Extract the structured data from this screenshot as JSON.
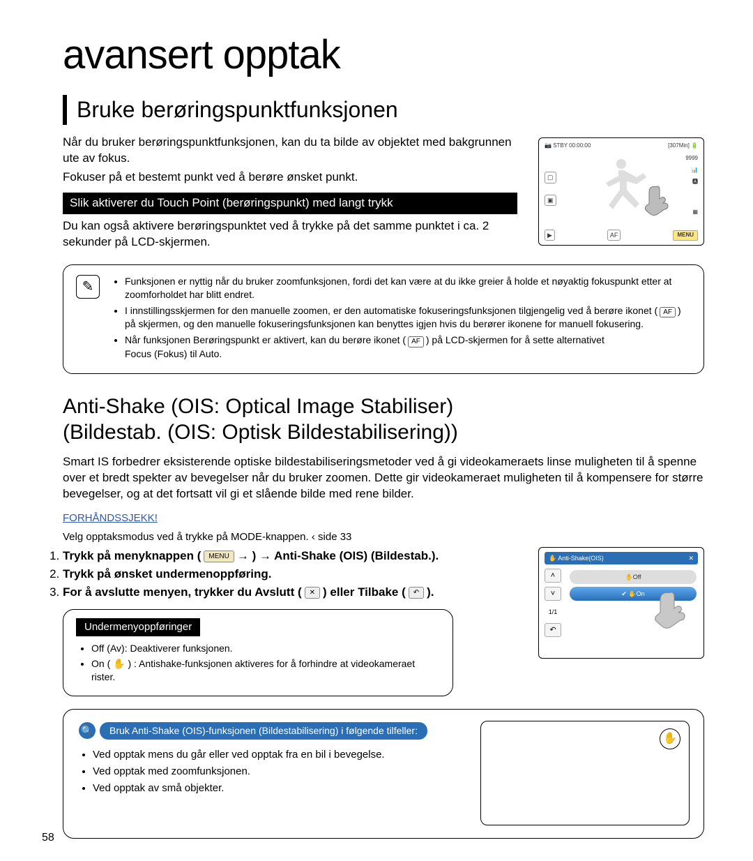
{
  "page_number": "58",
  "page_title": "avansert opptak",
  "section1": {
    "heading": "Bruke berøringspunktfunksjonen",
    "intro1": "Når du bruker berøringspunktfunksjonen, kan du ta bilde av objektet med bakgrunnen ute av fokus.",
    "intro2": "Fokuser på et bestemt punkt ved å berøre ønsket punkt.",
    "black_bar": "Slik aktiverer du Touch Point (berøringspunkt) med langt trykk",
    "after_bar": "Du kan også aktivere berøringspunktet ved å trykke på det samme punktet i ca. 2 sekunder på LCD-skjermen.",
    "lcd": {
      "stby": "STBY",
      "time": "00:00:00",
      "remain": "[307Min]",
      "res": "9999",
      "af": "AF",
      "menu": "MENU"
    },
    "note": {
      "b1": "Funksjonen er nyttig når du bruker zoomfunksjonen, fordi det kan være at du ikke greier å holde et nøyaktig fokuspunkt etter at zoomforholdet har blitt endret.",
      "b2a": "I innstillingsskjermen for den manuelle zoomen, er den automatiske fokuseringsfunksjonen tilgjengelig ved å berøre ikonet (",
      "b2b": ") på skjermen, og den manuelle fokuseringsfunksjonen kan benyttes igjen hvis du berører ikonene for manuell fokusering.",
      "b3a": "Når funksjonen Berøringspunkt er aktivert, kan du berøre ikonet (",
      "b3b": ") på LCD-skjermen for å sette alternativet",
      "b3c": "Focus (Fokus) til Auto."
    }
  },
  "section2": {
    "heading_line1": "Anti-Shake (OIS: Optical Image Stabiliser)",
    "heading_line2": "(Bildestab. (OIS: Optisk Bildestabilisering))",
    "para": "Smart IS forbedrer eksisterende optiske bildestabiliseringsmetoder ved å gi videokameraets linse muligheten til å spenne over et bredt spekter av bevegelser når du bruker zoomen. Dette gir videokameraet muligheten til å kompensere for større bevegelser, og at det fortsatt vil gi et slående bilde med rene bilder.",
    "precheck": "FORHÅNDSSJEKK!",
    "precheck_line": "Velg opptaksmodus ved å trykke på MODE-knappen.    ‹ side 33",
    "step1a": "Trykk på menyknappen (",
    "step1b": ") → Anti-Shake (OIS) (Bildestab.).",
    "step2": "Trykk på ønsket undermenoppføring.",
    "step3a": "For å avslutte menyen, trykker du Avslutt (",
    "step3b": ") eller Tilbake (",
    "step3c": ").",
    "menu_label": "MENU",
    "close_label": "✕",
    "back_label": "↶",
    "lcd2": {
      "title": "Anti-Shake(OIS)",
      "off": "Off",
      "on": "On",
      "page": "1/1"
    },
    "submenu": {
      "title": "Undermenyoppføringer",
      "off": "Off (Av): Deaktiverer funksjonen.",
      "on_a": "On ( ",
      "on_b": " ) : Antishake-funksjonen aktiveres for å forhindre at videokameraet rister."
    },
    "tip": {
      "pill": "Bruk Anti-Shake (OIS)-funksjonen (Bildestabilisering) i følgende tilfeller:",
      "b1": "Ved opptak mens du går eller ved opptak fra en bil i bevegelse.",
      "b2": "Ved opptak med zoomfunksjonen.",
      "b3": "Ved opptak av små objekter."
    }
  }
}
